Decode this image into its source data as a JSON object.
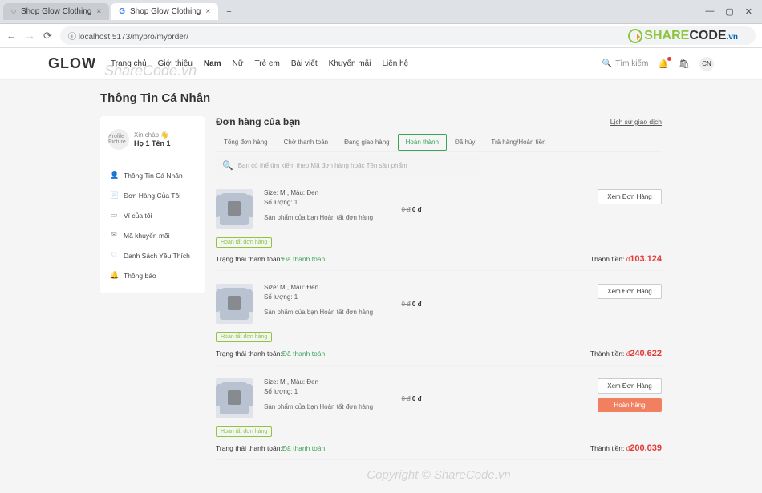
{
  "browser": {
    "tab1": "Shop Glow Clothing",
    "tab2": "Shop Glow Clothing",
    "url": "localhost:5173/mypro/myorder/",
    "win_min": "—",
    "win_max": "▢",
    "win_close": "✕"
  },
  "header": {
    "logo": "GLOW",
    "nav": [
      "Trang chủ",
      "Giới thiệu",
      "Nam",
      "Nữ",
      "Trẻ em",
      "Bài viết",
      "Khuyến mãi",
      "Liên hệ"
    ],
    "search_placeholder": "Tìm kiếm",
    "user_badge": "CN",
    "watermark": "ShareCode.vn",
    "sharecode_s": "SHARE",
    "sharecode_c": "CODE",
    "sharecode_vn": ".vn"
  },
  "page": {
    "title": "Thông Tin Cá Nhân",
    "greeting": "Xin chào 👋",
    "username": "Họ 1 Tên 1",
    "avatar_text": "Profile\nPicture"
  },
  "sidebar": [
    {
      "icon": "👤",
      "label": "Thông Tin Cá Nhân"
    },
    {
      "icon": "📄",
      "label": "Đơn Hàng Của Tôi"
    },
    {
      "icon": "▭",
      "label": "Ví của tôi"
    },
    {
      "icon": "✉",
      "label": "Mã khuyến mãi"
    },
    {
      "icon": "♡",
      "label": "Danh Sách Yêu Thích"
    },
    {
      "icon": "🔔",
      "label": "Thông báo"
    }
  ],
  "orders": {
    "title": "Đơn hàng của bạn",
    "history": "Lịch sử giao dịch",
    "tabs": [
      "Tổng đơn hàng",
      "Chờ thanh toán",
      "Đang giao hàng",
      "Hoàn thành",
      "Đã hủy",
      "Trả hàng/Hoàn tiền"
    ],
    "active_tab": 3,
    "search_placeholder": "Bạn có thể tìm kiếm theo Mã đơn hàng hoặc Tên sản phẩm",
    "attrs_label": "Size: M , Màu: Đen",
    "qty_label": "Số lượng: 1",
    "status_text": "Sản phẩm của bạn Hoàn tất đơn hàng",
    "price_strike": "0 đ",
    "price_now": "0 đ",
    "view_btn": "Xem Đơn Hàng",
    "return_btn": "Hoàn hàng",
    "badge": "Hoàn tất đơn hàng",
    "pay_label": "Trạng thái thanh toán:",
    "paid": "Đã thanh toán",
    "total_label": "Thành tiền:",
    "currency": "đ",
    "list": [
      {
        "total": "103.124",
        "return": false
      },
      {
        "total": "240.622",
        "return": false
      },
      {
        "total": "200.039",
        "return": true
      }
    ]
  },
  "footer_wm": "Copyright © ShareCode.vn"
}
